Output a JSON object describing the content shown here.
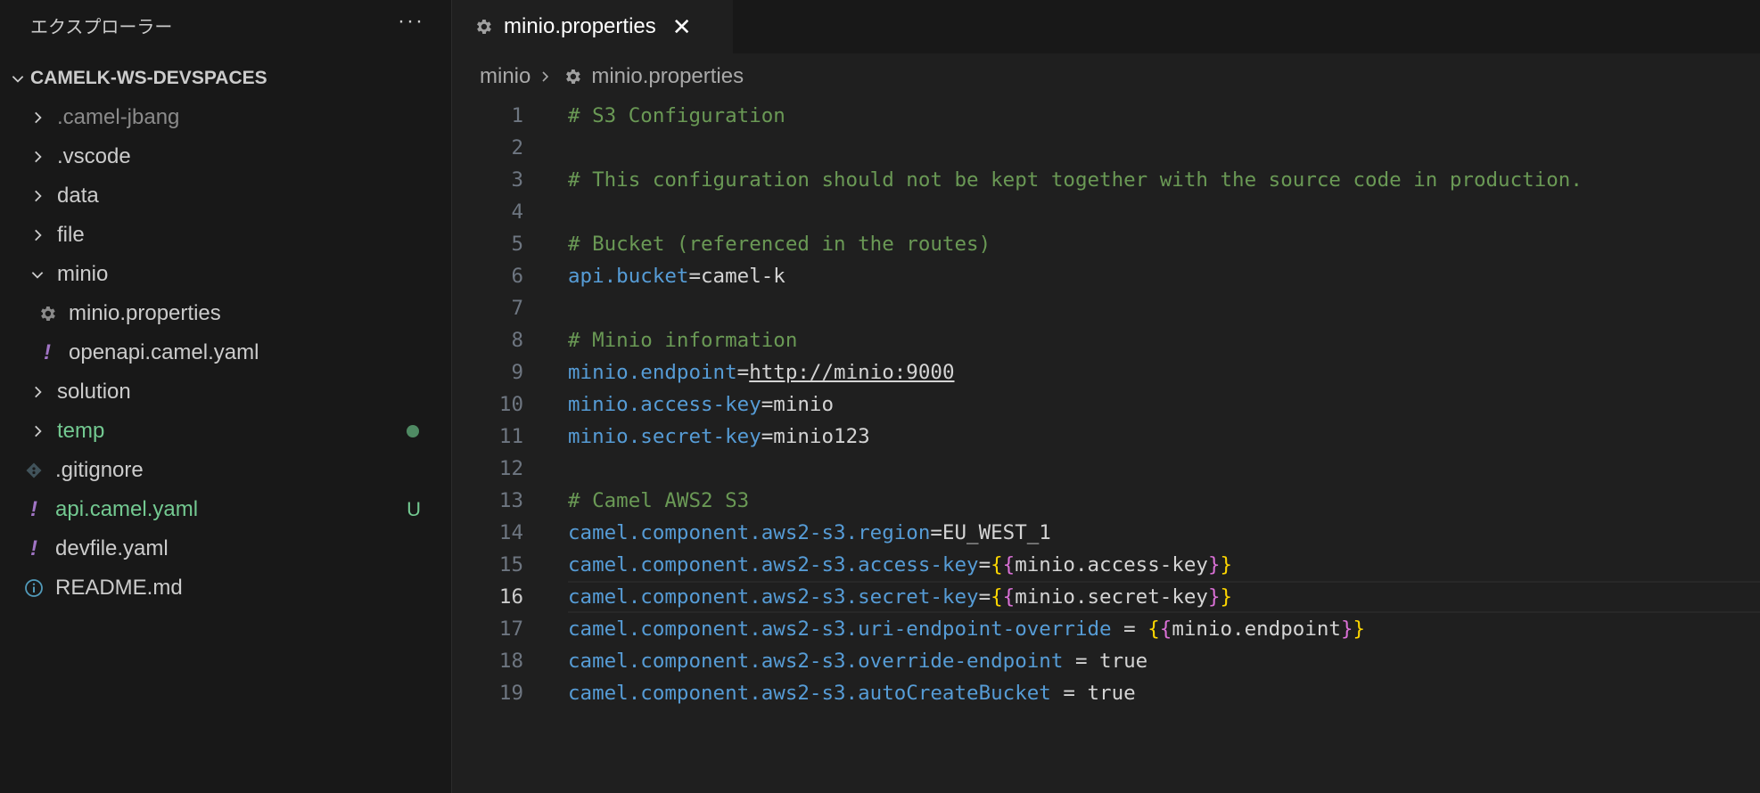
{
  "explorer": {
    "title": "エクスプローラー",
    "more_label": "···",
    "workspace": "CAMELK-WS-DEVSPACES",
    "items": [
      {
        "label": ".camel-jbang",
        "color": "#8b8b8b"
      },
      {
        "label": ".vscode",
        "color": "#cccccc"
      },
      {
        "label": "data",
        "color": "#cccccc"
      },
      {
        "label": "file",
        "color": "#cccccc"
      },
      {
        "label": "minio",
        "color": "#cccccc"
      },
      {
        "label": "minio.properties",
        "color": "#cccccc"
      },
      {
        "label": "openapi.camel.yaml",
        "color": "#cccccc"
      },
      {
        "label": "solution",
        "color": "#cccccc"
      },
      {
        "label": "temp",
        "color": "#73c991"
      },
      {
        "label": ".gitignore",
        "color": "#cccccc"
      },
      {
        "label": "api.camel.yaml",
        "color": "#73c991",
        "badge": "U"
      },
      {
        "label": "devfile.yaml",
        "color": "#cccccc"
      },
      {
        "label": "README.md",
        "color": "#cccccc"
      }
    ]
  },
  "tab": {
    "label": "minio.properties",
    "close": "✕"
  },
  "breadcrumb": {
    "folder": "minio",
    "file": "minio.properties"
  },
  "editor": {
    "active_line": 16,
    "lines": [
      {
        "n": "1",
        "tokens": [
          {
            "t": "# S3 Configuration",
            "c": "c"
          }
        ]
      },
      {
        "n": "2",
        "tokens": []
      },
      {
        "n": "3",
        "tokens": [
          {
            "t": "# This configuration should not be kept together with the source code in production.",
            "c": "c"
          }
        ]
      },
      {
        "n": "4",
        "tokens": []
      },
      {
        "n": "5",
        "tokens": [
          {
            "t": "# Bucket (referenced in the routes)",
            "c": "c"
          }
        ]
      },
      {
        "n": "6",
        "tokens": [
          {
            "t": "api.bucket",
            "c": "k"
          },
          {
            "t": "=camel-k",
            "c": "v"
          }
        ]
      },
      {
        "n": "7",
        "tokens": []
      },
      {
        "n": "8",
        "tokens": [
          {
            "t": "# Minio information",
            "c": "c"
          }
        ]
      },
      {
        "n": "9",
        "tokens": [
          {
            "t": "minio.endpoint",
            "c": "k"
          },
          {
            "t": "=",
            "c": "v"
          },
          {
            "t": "http://minio:9000",
            "c": "u"
          }
        ]
      },
      {
        "n": "10",
        "tokens": [
          {
            "t": "minio.access-key",
            "c": "k"
          },
          {
            "t": "=minio",
            "c": "v"
          }
        ]
      },
      {
        "n": "11",
        "tokens": [
          {
            "t": "minio.secret-key",
            "c": "k"
          },
          {
            "t": "=minio123",
            "c": "v"
          }
        ]
      },
      {
        "n": "12",
        "tokens": []
      },
      {
        "n": "13",
        "tokens": [
          {
            "t": "# Camel AWS2 S3",
            "c": "c"
          }
        ]
      },
      {
        "n": "14",
        "tokens": [
          {
            "t": "camel.component.aws2-s3.region",
            "c": "k"
          },
          {
            "t": "=EU_WEST_1",
            "c": "v"
          }
        ]
      },
      {
        "n": "15",
        "tokens": [
          {
            "t": "camel.component.aws2-s3.access-key",
            "c": "k"
          },
          {
            "t": "=",
            "c": "v"
          },
          {
            "t": "{",
            "c": "b1"
          },
          {
            "t": "{",
            "c": "b2"
          },
          {
            "t": "minio.access-key",
            "c": "v"
          },
          {
            "t": "}",
            "c": "b2"
          },
          {
            "t": "}",
            "c": "b1"
          }
        ]
      },
      {
        "n": "16",
        "tokens": [
          {
            "t": "camel.component.aws2-s3.secret-key",
            "c": "k"
          },
          {
            "t": "=",
            "c": "v"
          },
          {
            "t": "{",
            "c": "b1"
          },
          {
            "t": "{",
            "c": "b2"
          },
          {
            "t": "minio.secret-key",
            "c": "v"
          },
          {
            "t": "}",
            "c": "b2"
          },
          {
            "t": "}",
            "c": "b1"
          }
        ]
      },
      {
        "n": "17",
        "tokens": [
          {
            "t": "camel.component.aws2-s3.uri-endpoint-override",
            "c": "k"
          },
          {
            "t": " = ",
            "c": "v"
          },
          {
            "t": "{",
            "c": "b1"
          },
          {
            "t": "{",
            "c": "b2"
          },
          {
            "t": "minio.endpoint",
            "c": "v"
          },
          {
            "t": "}",
            "c": "b2"
          },
          {
            "t": "}",
            "c": "b1"
          }
        ]
      },
      {
        "n": "18",
        "tokens": [
          {
            "t": "camel.component.aws2-s3.override-endpoint",
            "c": "k"
          },
          {
            "t": " = true",
            "c": "v"
          }
        ]
      },
      {
        "n": "19",
        "tokens": [
          {
            "t": "camel.component.aws2-s3.autoCreateBucket",
            "c": "k"
          },
          {
            "t": " = true",
            "c": "v"
          }
        ]
      }
    ]
  }
}
